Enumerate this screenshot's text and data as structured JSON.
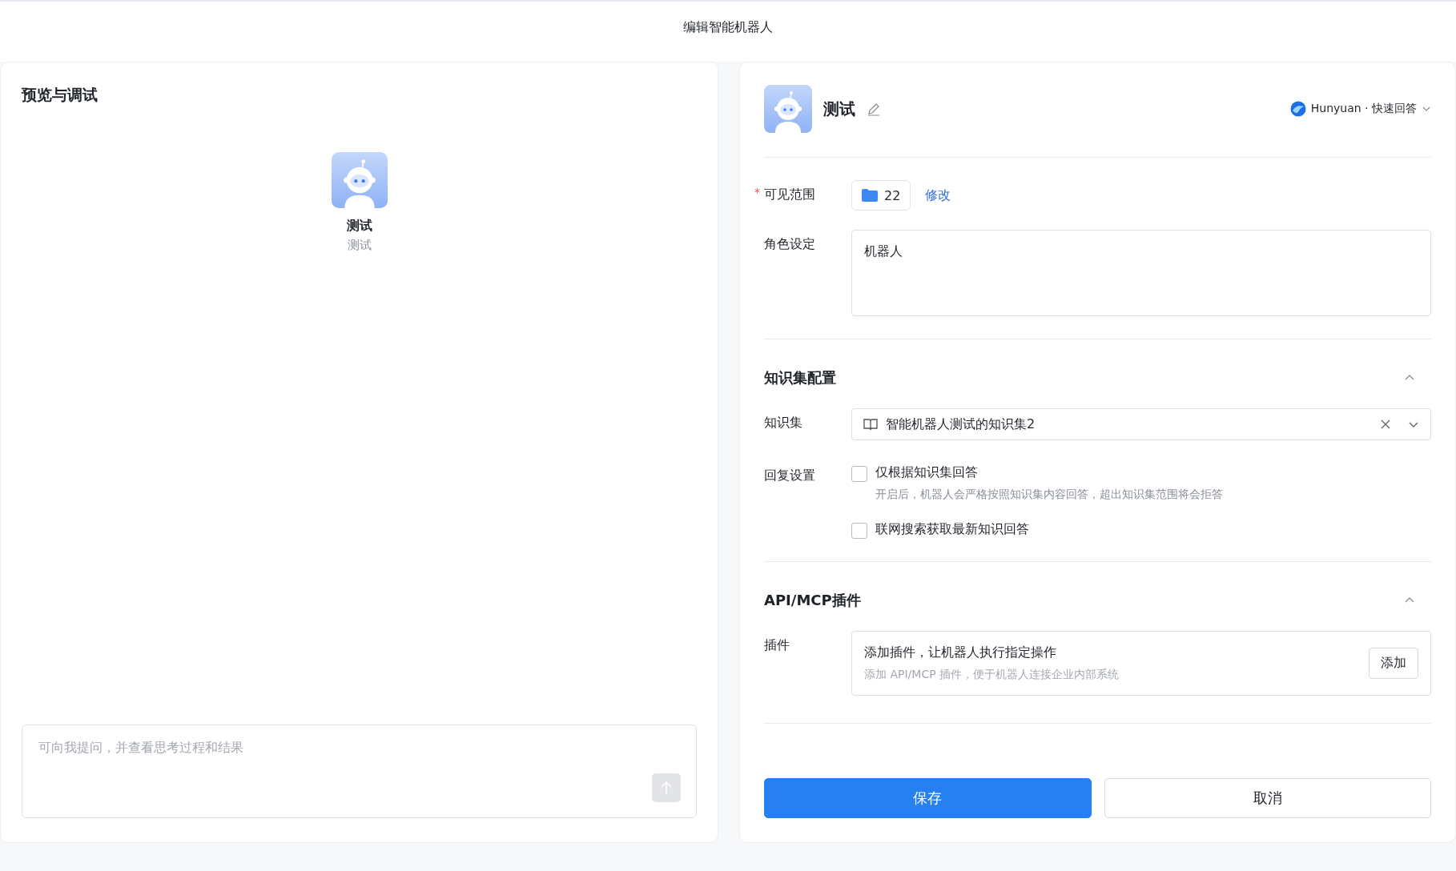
{
  "window": {
    "title": "编辑智能机器人"
  },
  "preview": {
    "title": "预览与调试",
    "bot_name": "测试",
    "bot_description": "测试",
    "input": {
      "placeholder": "可向我提问，并查看思考过程和结果"
    }
  },
  "editor": {
    "bot_name": "测试",
    "model": "Hunyuan · 快速回答",
    "visibility": {
      "label": "可见范围",
      "required_mark": "*",
      "count": "22",
      "action": "修改"
    },
    "role": {
      "label": "角色设定",
      "value": "机器人"
    },
    "sections": [
      {
        "kind": "knowledge",
        "title": "知识集配置",
        "expanded": true,
        "field_label": "知识集",
        "value": "智能机器人测试的知识集2",
        "reply_label": "回复设置",
        "options": [
          {
            "label": "仅根据知识集回答",
            "checked": false,
            "hint": "开启后，机器人会严格按照知识集内容回答，超出知识集范围将会拒答"
          },
          {
            "label": "联网搜索获取最新知识回答",
            "checked": false
          }
        ]
      },
      {
        "kind": "plugins",
        "title": "API/MCP插件",
        "expanded": true,
        "field_label": "插件",
        "heading": "添加插件，让机器人执行指定操作",
        "description": "添加 API/MCP 插件，便于机器人连接企业内部系统",
        "button": "添加"
      }
    ],
    "buttons": [
      {
        "label": "保存",
        "kind": "primary"
      },
      {
        "label": "取消",
        "kind": "secondary"
      }
    ]
  }
}
